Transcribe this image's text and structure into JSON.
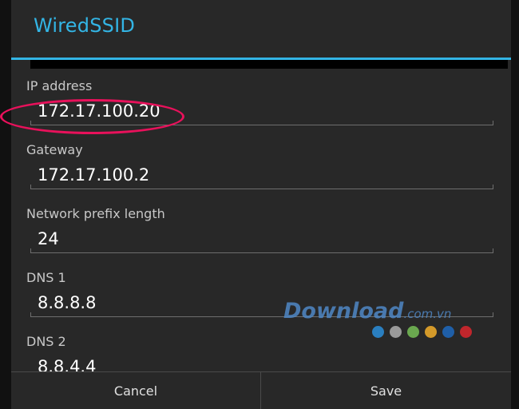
{
  "dialog": {
    "title": "WiredSSID"
  },
  "fields": [
    {
      "label": "IP address",
      "value": "172.17.100.20"
    },
    {
      "label": "Gateway",
      "value": "172.17.100.2"
    },
    {
      "label": "Network prefix length",
      "value": "24"
    },
    {
      "label": "DNS 1",
      "value": "8.8.8.8"
    },
    {
      "label": "DNS 2",
      "value": "8.8.4.4"
    }
  ],
  "buttons": {
    "cancel": "Cancel",
    "save": "Save"
  },
  "watermark": {
    "text": "Download",
    "suffix": ".com.vn",
    "dot_colors": [
      "#2a7fc0",
      "#9a9a9a",
      "#6aa84f",
      "#d49a2a",
      "#1f5fa8",
      "#c0262c"
    ]
  },
  "colors": {
    "accent": "#33b5e5",
    "highlight": "#e8115b",
    "dialog_bg": "#282828"
  }
}
